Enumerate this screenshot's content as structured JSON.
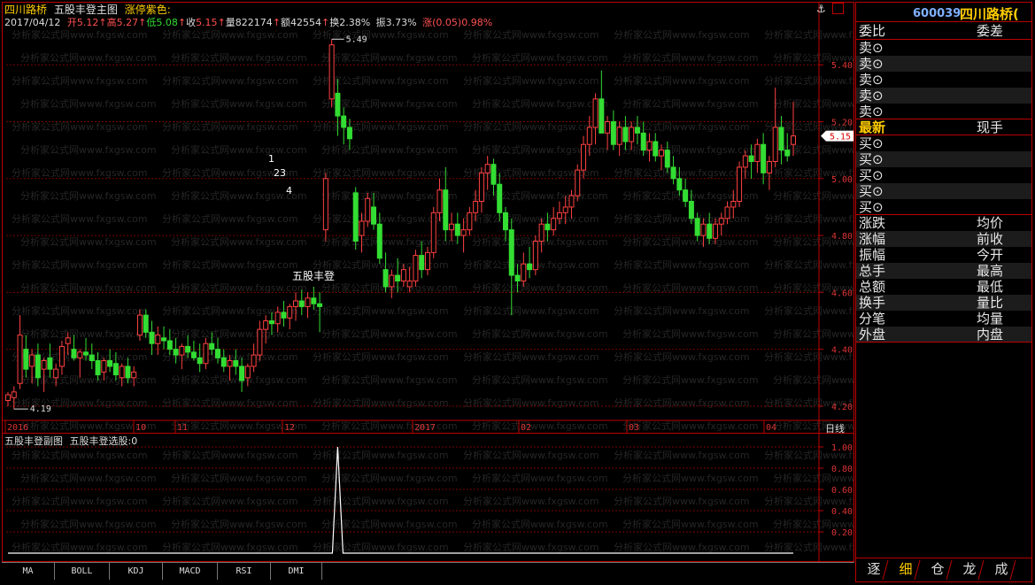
{
  "header": {
    "stock_name": "四川路桥",
    "indicator_name": "五股丰登主图",
    "limit_color_label": "涨停紫色:",
    "date": "2017/04/12",
    "open_label": "开",
    "open_value": "5.12",
    "high_label": "高",
    "high_value": "5.27",
    "low_label": "低",
    "low_value": "5.08",
    "close_label": "收",
    "close_value": "5.15",
    "volume_label": "量",
    "volume_value": "822174",
    "amount_label": "额",
    "amount_value": "42554",
    "turnover_label": "换",
    "turnover_value": "2.38%",
    "amplitude_label": "振",
    "amplitude_value": "3.73%",
    "change_label": "涨",
    "change_value": "(0.05)",
    "change_pct": "0.98%"
  },
  "main_chart": {
    "price_labels": [
      "5.40",
      "5.20",
      "5.00",
      "4.80",
      "4.60",
      "4.40",
      "4.20"
    ],
    "current_price_tag": "5.15",
    "max_marker": "5.49",
    "min_marker": "4.19",
    "signal_text": "五股丰登",
    "wave_labels": [
      "1",
      "23",
      "4"
    ],
    "date_labels": [
      "2016",
      "10",
      "11",
      "12",
      "2017",
      "02",
      "03",
      "04"
    ],
    "period_label": "日线",
    "watermark": "分析家公式网www.fxgsw.com"
  },
  "sub_chart": {
    "title": "五股丰登副图",
    "signal_name": "五股丰登选股:",
    "signal_value": "0",
    "scale_labels": [
      "1.00",
      "0.80",
      "0.60",
      "0.40",
      "0.20"
    ]
  },
  "tabs": [
    "MA",
    "BOLL",
    "KDJ",
    "MACD",
    "RSI",
    "DMI"
  ],
  "right_panel": {
    "code": "600039",
    "name": "四川路桥(",
    "weibi": "委比",
    "weicha": "委差",
    "sell_rows": [
      "卖⊙",
      "卖⊙",
      "卖⊙",
      "卖⊙",
      "卖⊙"
    ],
    "latest": "最新",
    "xianshou": "现手",
    "buy_rows": [
      "买⊙",
      "买⊙",
      "买⊙",
      "买⊙",
      "买⊙"
    ],
    "stats": [
      [
        "涨跌",
        "均价"
      ],
      [
        "涨幅",
        "前收"
      ],
      [
        "振幅",
        "今开"
      ],
      [
        "总手",
        "最高"
      ],
      [
        "总额",
        "最低"
      ],
      [
        "换手",
        "量比"
      ],
      [
        "分笔",
        "均量"
      ],
      [
        "外盘",
        "内盘"
      ]
    ],
    "bottom_tabs": [
      "逐",
      "细",
      "仓",
      "龙",
      "成"
    ]
  },
  "toolbar": {
    "anchor_icon": "anchor-icon"
  },
  "chart_data": {
    "type": "candlestick",
    "y_range": [
      4.15,
      5.55
    ],
    "candles": [
      [
        4.22,
        4.25,
        4.2,
        4.24
      ],
      [
        4.23,
        4.27,
        4.19,
        4.25
      ],
      [
        4.28,
        4.52,
        4.26,
        4.45
      ],
      [
        4.4,
        4.45,
        4.3,
        4.33
      ],
      [
        4.34,
        4.4,
        4.28,
        4.38
      ],
      [
        4.38,
        4.42,
        4.27,
        4.3
      ],
      [
        4.33,
        4.37,
        4.25,
        4.36
      ],
      [
        4.37,
        4.42,
        4.3,
        4.33
      ],
      [
        4.3,
        4.35,
        4.27,
        4.33
      ],
      [
        4.34,
        4.43,
        4.31,
        4.41
      ],
      [
        4.42,
        4.46,
        4.38,
        4.44
      ],
      [
        4.4,
        4.45,
        4.36,
        4.37
      ],
      [
        4.37,
        4.4,
        4.3,
        4.39
      ],
      [
        4.39,
        4.44,
        4.36,
        4.38
      ],
      [
        4.38,
        4.42,
        4.33,
        4.36
      ],
      [
        4.36,
        4.39,
        4.29,
        4.31
      ],
      [
        4.32,
        4.37,
        4.29,
        4.36
      ],
      [
        4.36,
        4.4,
        4.32,
        4.34
      ],
      [
        4.35,
        4.39,
        4.29,
        4.31
      ],
      [
        4.3,
        4.35,
        4.27,
        4.34
      ],
      [
        4.34,
        4.37,
        4.28,
        4.3
      ],
      [
        4.3,
        4.34,
        4.27,
        4.32
      ],
      [
        4.45,
        4.54,
        4.43,
        4.52
      ],
      [
        4.52,
        4.54,
        4.44,
        4.46
      ],
      [
        4.46,
        4.5,
        4.38,
        4.42
      ],
      [
        4.42,
        4.48,
        4.38,
        4.45
      ],
      [
        4.44,
        4.48,
        4.4,
        4.43
      ],
      [
        4.43,
        4.47,
        4.38,
        4.4
      ],
      [
        4.4,
        4.44,
        4.35,
        4.38
      ],
      [
        4.38,
        4.42,
        4.33,
        4.41
      ],
      [
        4.41,
        4.45,
        4.37,
        4.39
      ],
      [
        4.39,
        4.43,
        4.36,
        4.37
      ],
      [
        4.37,
        4.42,
        4.32,
        4.35
      ],
      [
        4.35,
        4.44,
        4.33,
        4.42
      ],
      [
        4.42,
        4.46,
        4.38,
        4.4
      ],
      [
        4.4,
        4.44,
        4.35,
        4.37
      ],
      [
        4.37,
        4.4,
        4.32,
        4.34
      ],
      [
        4.34,
        4.38,
        4.29,
        4.36
      ],
      [
        4.36,
        4.4,
        4.31,
        4.34
      ],
      [
        4.34,
        4.37,
        4.25,
        4.29
      ],
      [
        4.3,
        4.35,
        4.27,
        4.34
      ],
      [
        4.34,
        4.42,
        4.32,
        4.38
      ],
      [
        4.38,
        4.5,
        4.36,
        4.47
      ],
      [
        4.47,
        4.52,
        4.42,
        4.5
      ],
      [
        4.5,
        4.53,
        4.45,
        4.49
      ],
      [
        4.49,
        4.55,
        4.46,
        4.53
      ],
      [
        4.53,
        4.57,
        4.48,
        4.51
      ],
      [
        4.51,
        4.56,
        4.47,
        4.55
      ],
      [
        4.55,
        4.6,
        4.5,
        4.57
      ],
      [
        4.57,
        4.61,
        4.52,
        4.55
      ],
      [
        4.55,
        4.6,
        4.51,
        4.58
      ],
      [
        4.58,
        4.62,
        4.54,
        4.56
      ],
      [
        4.56,
        4.6,
        4.46,
        4.55
      ],
      [
        4.82,
        5.02,
        4.78,
        5.0
      ],
      [
        5.28,
        5.49,
        5.25,
        5.47
      ],
      [
        5.3,
        5.35,
        5.15,
        5.22
      ],
      [
        5.22,
        5.25,
        5.12,
        5.18
      ],
      [
        5.18,
        5.21,
        5.1,
        5.14
      ],
      [
        4.95,
        4.97,
        4.75,
        4.78
      ],
      [
        4.8,
        4.88,
        4.74,
        4.85
      ],
      [
        4.85,
        4.95,
        4.83,
        4.93
      ],
      [
        4.9,
        4.95,
        4.82,
        4.84
      ],
      [
        4.84,
        4.88,
        4.7,
        4.72
      ],
      [
        4.68,
        4.74,
        4.6,
        4.62
      ],
      [
        4.62,
        4.68,
        4.58,
        4.66
      ],
      [
        4.66,
        4.72,
        4.6,
        4.64
      ],
      [
        4.64,
        4.7,
        4.62,
        4.68
      ],
      [
        4.62,
        4.69,
        4.6,
        4.64
      ],
      [
        4.64,
        4.75,
        4.62,
        4.73
      ],
      [
        4.73,
        4.78,
        4.65,
        4.68
      ],
      [
        4.68,
        4.76,
        4.66,
        4.74
      ],
      [
        4.74,
        4.9,
        4.72,
        4.88
      ],
      [
        4.88,
        5.0,
        4.85,
        4.96
      ],
      [
        4.96,
        5.04,
        4.78,
        4.82
      ],
      [
        4.82,
        4.88,
        4.78,
        4.84
      ],
      [
        4.84,
        4.88,
        4.77,
        4.8
      ],
      [
        4.8,
        4.86,
        4.74,
        4.82
      ],
      [
        4.82,
        4.9,
        4.8,
        4.88
      ],
      [
        4.88,
        4.96,
        4.85,
        4.92
      ],
      [
        4.92,
        5.04,
        4.88,
        5.02
      ],
      [
        5.02,
        5.08,
        4.96,
        5.05
      ],
      [
        5.05,
        5.07,
        4.94,
        4.98
      ],
      [
        4.98,
        5.02,
        4.85,
        4.88
      ],
      [
        4.88,
        4.9,
        4.78,
        4.82
      ],
      [
        4.82,
        4.86,
        4.52,
        4.66
      ],
      [
        4.66,
        4.7,
        4.6,
        4.64
      ],
      [
        4.64,
        4.74,
        4.62,
        4.7
      ],
      [
        4.7,
        4.76,
        4.65,
        4.68
      ],
      [
        4.68,
        4.8,
        4.66,
        4.78
      ],
      [
        4.78,
        4.86,
        4.74,
        4.84
      ],
      [
        4.84,
        4.88,
        4.78,
        4.82
      ],
      [
        4.82,
        4.9,
        4.8,
        4.86
      ],
      [
        4.86,
        4.92,
        4.84,
        4.88
      ],
      [
        4.88,
        4.94,
        4.84,
        4.9
      ],
      [
        4.9,
        4.96,
        4.86,
        4.94
      ],
      [
        4.94,
        5.05,
        4.92,
        5.03
      ],
      [
        5.03,
        5.15,
        5.0,
        5.12
      ],
      [
        5.12,
        5.22,
        5.08,
        5.18
      ],
      [
        5.18,
        5.3,
        5.12,
        5.28
      ],
      [
        5.28,
        5.38,
        5.2,
        5.16
      ],
      [
        5.16,
        5.22,
        5.1,
        5.2
      ],
      [
        5.2,
        5.24,
        5.1,
        5.12
      ],
      [
        5.12,
        5.2,
        5.08,
        5.18
      ],
      [
        5.18,
        5.22,
        5.1,
        5.13
      ],
      [
        5.13,
        5.2,
        5.1,
        5.18
      ],
      [
        5.18,
        5.22,
        5.12,
        5.16
      ],
      [
        5.16,
        5.2,
        5.08,
        5.1
      ],
      [
        5.1,
        5.16,
        5.06,
        5.13
      ],
      [
        5.13,
        5.16,
        5.06,
        5.08
      ],
      [
        5.08,
        5.12,
        5.03,
        5.1
      ],
      [
        5.1,
        5.13,
        5.02,
        5.04
      ],
      [
        5.04,
        5.08,
        4.98,
        5.0
      ],
      [
        5.0,
        5.04,
        4.94,
        4.96
      ],
      [
        4.96,
        5.0,
        4.9,
        4.92
      ],
      [
        4.92,
        4.96,
        4.84,
        4.86
      ],
      [
        4.86,
        4.88,
        4.78,
        4.8
      ],
      [
        4.8,
        4.86,
        4.76,
        4.84
      ],
      [
        4.84,
        4.88,
        4.77,
        4.79
      ],
      [
        4.79,
        4.86,
        4.77,
        4.84
      ],
      [
        4.84,
        4.88,
        4.8,
        4.86
      ],
      [
        4.86,
        4.92,
        4.84,
        4.9
      ],
      [
        4.9,
        4.96,
        4.86,
        4.92
      ],
      [
        4.92,
        5.06,
        4.9,
        5.04
      ],
      [
        5.04,
        5.1,
        5.0,
        5.08
      ],
      [
        5.08,
        5.12,
        5.0,
        5.06
      ],
      [
        5.06,
        5.14,
        5.02,
        5.12
      ],
      [
        5.12,
        5.16,
        4.98,
        5.02
      ],
      [
        5.02,
        5.08,
        4.96,
        5.06
      ],
      [
        5.06,
        5.32,
        5.04,
        5.18
      ],
      [
        5.18,
        5.22,
        5.05,
        5.1
      ],
      [
        5.1,
        5.16,
        5.06,
        5.08
      ],
      [
        5.12,
        5.27,
        5.08,
        5.15
      ]
    ],
    "signal_series_peak_index": 55
  }
}
